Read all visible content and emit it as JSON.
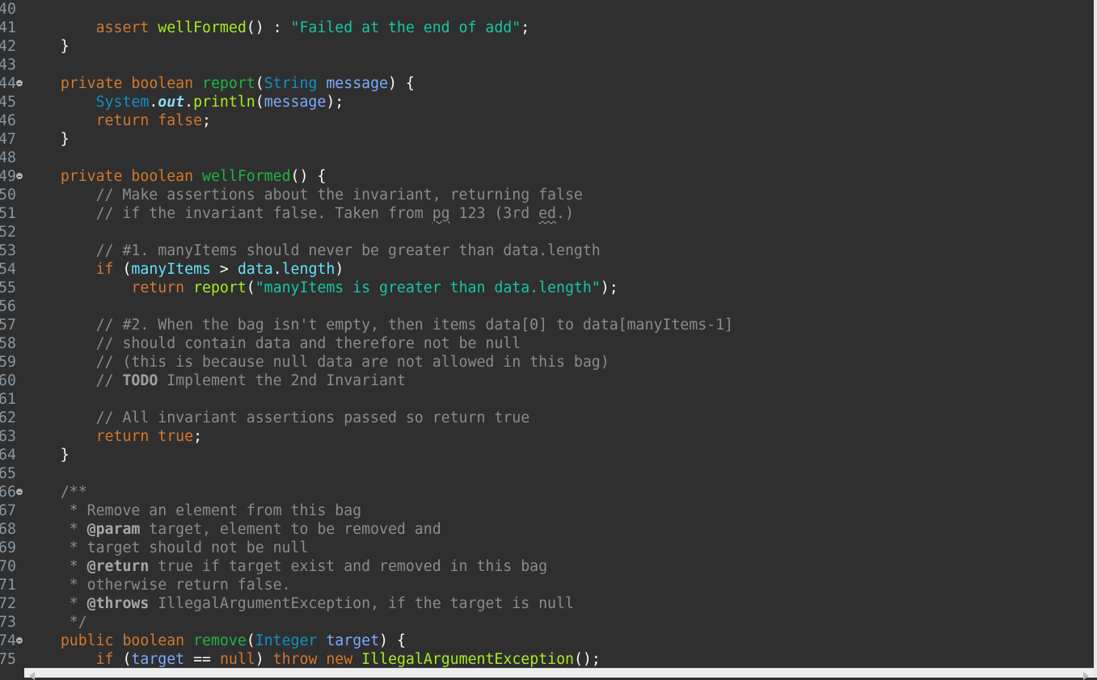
{
  "editor": {
    "language": "java",
    "colors": {
      "background": "#2f2f2f",
      "keyword": "#d2782f",
      "method_declaration": "#1eb540",
      "method_call": "#a7ec21",
      "string": "#17c6a3",
      "type": "#1290c3",
      "parameter": "#79abff",
      "field": "#66e1f8",
      "comment": "#8b8b8b",
      "line_number": "#8a959e"
    },
    "lines": [
      {
        "num": "40",
        "fold": false,
        "tokens": []
      },
      {
        "num": "41",
        "fold": false,
        "tokens": [
          {
            "t": "        ",
            "c": ""
          },
          {
            "t": "assert",
            "c": "kw"
          },
          {
            "t": " ",
            "c": ""
          },
          {
            "t": "wellFormed",
            "c": "mcall"
          },
          {
            "t": "() : ",
            "c": "punc"
          },
          {
            "t": "\"Failed at the end of add\"",
            "c": "str"
          },
          {
            "t": ";",
            "c": "punc"
          }
        ]
      },
      {
        "num": "42",
        "fold": false,
        "tokens": [
          {
            "t": "    }",
            "c": "punc"
          }
        ]
      },
      {
        "num": "43",
        "fold": false,
        "tokens": []
      },
      {
        "num": "44",
        "fold": true,
        "tokens": [
          {
            "t": "    ",
            "c": ""
          },
          {
            "t": "private",
            "c": "kw"
          },
          {
            "t": " ",
            "c": ""
          },
          {
            "t": "boolean",
            "c": "kw"
          },
          {
            "t": " ",
            "c": ""
          },
          {
            "t": "report",
            "c": "mdecl"
          },
          {
            "t": "(",
            "c": "punc"
          },
          {
            "t": "String",
            "c": "type"
          },
          {
            "t": " ",
            "c": ""
          },
          {
            "t": "message",
            "c": "param"
          },
          {
            "t": ") {",
            "c": "punc"
          }
        ]
      },
      {
        "num": "45",
        "fold": false,
        "tokens": [
          {
            "t": "        ",
            "c": ""
          },
          {
            "t": "System",
            "c": "type"
          },
          {
            "t": ".",
            "c": "punc"
          },
          {
            "t": "out",
            "c": "static"
          },
          {
            "t": ".",
            "c": "punc"
          },
          {
            "t": "println",
            "c": "mcall"
          },
          {
            "t": "(",
            "c": "punc"
          },
          {
            "t": "message",
            "c": "param"
          },
          {
            "t": ");",
            "c": "punc"
          }
        ]
      },
      {
        "num": "46",
        "fold": false,
        "tokens": [
          {
            "t": "        ",
            "c": ""
          },
          {
            "t": "return",
            "c": "kw"
          },
          {
            "t": " ",
            "c": ""
          },
          {
            "t": "false",
            "c": "kw"
          },
          {
            "t": ";",
            "c": "punc"
          }
        ]
      },
      {
        "num": "47",
        "fold": false,
        "tokens": [
          {
            "t": "    }",
            "c": "punc"
          }
        ]
      },
      {
        "num": "48",
        "fold": false,
        "tokens": []
      },
      {
        "num": "49",
        "fold": true,
        "tokens": [
          {
            "t": "    ",
            "c": ""
          },
          {
            "t": "private",
            "c": "kw"
          },
          {
            "t": " ",
            "c": ""
          },
          {
            "t": "boolean",
            "c": "kw"
          },
          {
            "t": " ",
            "c": ""
          },
          {
            "t": "wellFormed",
            "c": "mdecl"
          },
          {
            "t": "() {",
            "c": "punc"
          }
        ]
      },
      {
        "num": "50",
        "fold": false,
        "tokens": [
          {
            "t": "        ",
            "c": ""
          },
          {
            "t": "// Make assertions about the invariant, returning false",
            "c": "cm"
          }
        ]
      },
      {
        "num": "51",
        "fold": false,
        "tokens": [
          {
            "t": "        ",
            "c": ""
          },
          {
            "t": "// if the invariant false. Taken from ",
            "c": "cm"
          },
          {
            "t": "pg",
            "c": "cm sq"
          },
          {
            "t": " 123 (3rd ",
            "c": "cm"
          },
          {
            "t": "ed",
            "c": "cm sq"
          },
          {
            "t": ".)",
            "c": "cm"
          }
        ]
      },
      {
        "num": "52",
        "fold": false,
        "tokens": []
      },
      {
        "num": "53",
        "fold": false,
        "tokens": [
          {
            "t": "        ",
            "c": ""
          },
          {
            "t": "// #1. manyItems should never be greater than data.length",
            "c": "cm"
          }
        ]
      },
      {
        "num": "54",
        "fold": false,
        "tokens": [
          {
            "t": "        ",
            "c": ""
          },
          {
            "t": "if",
            "c": "kw"
          },
          {
            "t": " (",
            "c": "punc"
          },
          {
            "t": "manyItems",
            "c": "field"
          },
          {
            "t": " > ",
            "c": "punc"
          },
          {
            "t": "data",
            "c": "field"
          },
          {
            "t": ".",
            "c": "punc"
          },
          {
            "t": "length",
            "c": "field"
          },
          {
            "t": ")",
            "c": "punc"
          }
        ]
      },
      {
        "num": "55",
        "fold": false,
        "tokens": [
          {
            "t": "            ",
            "c": ""
          },
          {
            "t": "return",
            "c": "kw"
          },
          {
            "t": " ",
            "c": ""
          },
          {
            "t": "report",
            "c": "mcall"
          },
          {
            "t": "(",
            "c": "punc"
          },
          {
            "t": "\"manyItems is greater than data.length\"",
            "c": "str"
          },
          {
            "t": ");",
            "c": "punc"
          }
        ]
      },
      {
        "num": "56",
        "fold": false,
        "tokens": []
      },
      {
        "num": "57",
        "fold": false,
        "tokens": [
          {
            "t": "        ",
            "c": ""
          },
          {
            "t": "// #2. When the bag isn't empty, then items data[0] to data[manyItems-1]",
            "c": "cm"
          }
        ]
      },
      {
        "num": "58",
        "fold": false,
        "tokens": [
          {
            "t": "        ",
            "c": ""
          },
          {
            "t": "// should contain data and therefore not be null",
            "c": "cm"
          }
        ]
      },
      {
        "num": "59",
        "fold": false,
        "tokens": [
          {
            "t": "        ",
            "c": ""
          },
          {
            "t": "// (this is because null data are not allowed in this bag)",
            "c": "cm"
          }
        ]
      },
      {
        "num": "60",
        "fold": false,
        "tokens": [
          {
            "t": "        ",
            "c": ""
          },
          {
            "t": "// ",
            "c": "cm"
          },
          {
            "t": "TODO",
            "c": "todo"
          },
          {
            "t": " Implement the 2nd Invariant",
            "c": "cm"
          }
        ]
      },
      {
        "num": "61",
        "fold": false,
        "tokens": []
      },
      {
        "num": "62",
        "fold": false,
        "tokens": [
          {
            "t": "        ",
            "c": ""
          },
          {
            "t": "// All invariant assertions passed so return true",
            "c": "cm"
          }
        ]
      },
      {
        "num": "63",
        "fold": false,
        "tokens": [
          {
            "t": "        ",
            "c": ""
          },
          {
            "t": "return",
            "c": "kw"
          },
          {
            "t": " ",
            "c": ""
          },
          {
            "t": "true",
            "c": "kw"
          },
          {
            "t": ";",
            "c": "punc"
          }
        ]
      },
      {
        "num": "64",
        "fold": false,
        "tokens": [
          {
            "t": "    }",
            "c": "punc"
          }
        ]
      },
      {
        "num": "65",
        "fold": false,
        "tokens": []
      },
      {
        "num": "66",
        "fold": true,
        "tokens": [
          {
            "t": "    ",
            "c": ""
          },
          {
            "t": "/**",
            "c": "cm"
          }
        ]
      },
      {
        "num": "67",
        "fold": false,
        "tokens": [
          {
            "t": "     * Remove an element from this bag",
            "c": "cm"
          }
        ]
      },
      {
        "num": "68",
        "fold": false,
        "tokens": [
          {
            "t": "     * ",
            "c": "cm"
          },
          {
            "t": "@param",
            "c": "tag"
          },
          {
            "t": " target, element to be removed and",
            "c": "cm"
          }
        ]
      },
      {
        "num": "69",
        "fold": false,
        "tokens": [
          {
            "t": "     * target should not be null",
            "c": "cm"
          }
        ]
      },
      {
        "num": "70",
        "fold": false,
        "tokens": [
          {
            "t": "     * ",
            "c": "cm"
          },
          {
            "t": "@return",
            "c": "tag"
          },
          {
            "t": " true if target exist and removed in this bag",
            "c": "cm"
          }
        ]
      },
      {
        "num": "71",
        "fold": false,
        "tokens": [
          {
            "t": "     * otherwise return false.",
            "c": "cm"
          }
        ]
      },
      {
        "num": "72",
        "fold": false,
        "tokens": [
          {
            "t": "     * ",
            "c": "cm"
          },
          {
            "t": "@throws",
            "c": "tag"
          },
          {
            "t": " IllegalArgumentException, if the target is null",
            "c": "cm"
          }
        ]
      },
      {
        "num": "73",
        "fold": false,
        "tokens": [
          {
            "t": "     */",
            "c": "cm"
          }
        ]
      },
      {
        "num": "74",
        "fold": true,
        "tokens": [
          {
            "t": "    ",
            "c": ""
          },
          {
            "t": "public",
            "c": "kw"
          },
          {
            "t": " ",
            "c": ""
          },
          {
            "t": "boolean",
            "c": "kw"
          },
          {
            "t": " ",
            "c": ""
          },
          {
            "t": "remove",
            "c": "mdecl"
          },
          {
            "t": "(",
            "c": "punc"
          },
          {
            "t": "Integer",
            "c": "type"
          },
          {
            "t": " ",
            "c": ""
          },
          {
            "t": "target",
            "c": "param"
          },
          {
            "t": ") {",
            "c": "punc"
          }
        ]
      },
      {
        "num": "75",
        "fold": false,
        "tokens": [
          {
            "t": "        ",
            "c": ""
          },
          {
            "t": "if",
            "c": "kw"
          },
          {
            "t": " (",
            "c": "punc"
          },
          {
            "t": "target",
            "c": "param"
          },
          {
            "t": " == ",
            "c": "punc"
          },
          {
            "t": "null",
            "c": "kw"
          },
          {
            "t": ") ",
            "c": "punc"
          },
          {
            "t": "throw",
            "c": "kw"
          },
          {
            "t": " ",
            "c": ""
          },
          {
            "t": "new",
            "c": "kw"
          },
          {
            "t": " ",
            "c": ""
          },
          {
            "t": "IllegalArgumentException",
            "c": "mcall"
          },
          {
            "t": "();",
            "c": "punc"
          }
        ]
      }
    ]
  },
  "scrollbar": {
    "orientation": "horizontal",
    "left_arrow_icon": "triangle-left",
    "right_arrow_icon": "triangle-right"
  }
}
